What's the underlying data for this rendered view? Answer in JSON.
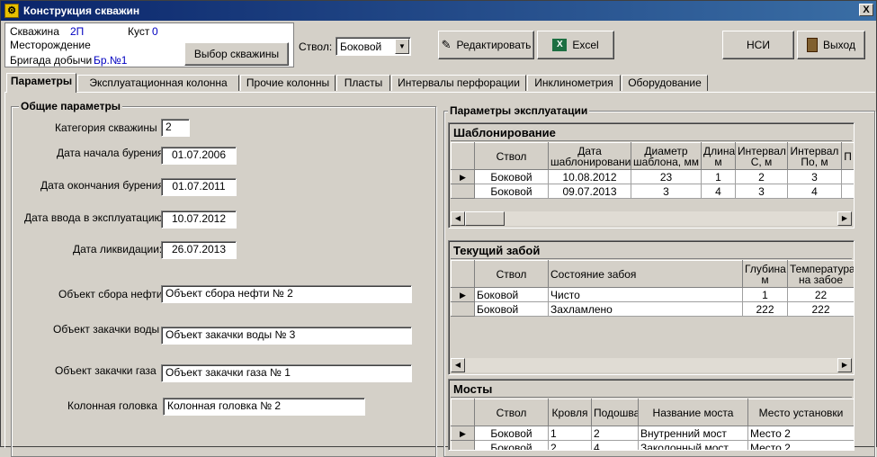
{
  "window": {
    "title": "Конструкция скважин",
    "close_label": "X"
  },
  "info": {
    "well_label": "Скважина",
    "well_value": "2П",
    "cluster_label": "Куст",
    "cluster_value": "0",
    "field_label": "Месторождение",
    "brigade_label": "Бригада добычи",
    "brigade_value": "Бр.№1"
  },
  "toolbar": {
    "select_well_label": "Выбор скважины",
    "trunk_label": "Ствол:",
    "trunk_value": "Боковой",
    "edit_label": "Редактировать",
    "excel_label": "Excel",
    "nsi_label": "НСИ",
    "exit_label": "Выход"
  },
  "tabs": [
    "Параметры",
    "Эксплуатационная колонна",
    "Прочие колонны",
    "Пласты",
    "Интервалы перфорации",
    "Инклинометрия",
    "Оборудование"
  ],
  "general": {
    "title": "Общие параметры",
    "category_label": "Категория скважины",
    "category_value": "2",
    "drill_start_label": "Дата начала бурения",
    "drill_start_value": "01.07.2006",
    "drill_end_label": "Дата окончания бурения",
    "drill_end_value": "01.07.2011",
    "commission_label": "Дата ввода в эксплуатацию",
    "commission_value": "10.07.2012",
    "liquidation_label": "Дата ликвидации:",
    "liquidation_value": "26.07.2013",
    "oil_label": "Объект сбора нефти",
    "oil_value": "Объект сбора нефти № 2",
    "water_label": "Объект закачки воды",
    "water_value": "Объект закачки воды № 3",
    "gas_label": "Объект закачки газа",
    "gas_value": "Объект закачки газа № 1",
    "head_label": "Колонная головка",
    "head_value": "Колонная головка № 2"
  },
  "exploitation": {
    "title": "Параметры эксплуатации",
    "templating": {
      "title": "Шаблонирование",
      "columns": [
        "Ствол",
        "Дата шаблонирования",
        "Диаметр шаблона, мм",
        "Длина м",
        "Интервал С, м",
        "Интервал По, м",
        "П"
      ],
      "rows": [
        [
          "Боковой",
          "10.08.2012",
          "23",
          "1",
          "2",
          "3"
        ],
        [
          "Боковой",
          "09.07.2013",
          "3",
          "4",
          "3",
          "4"
        ]
      ]
    },
    "bottomhole": {
      "title": "Текущий забой",
      "columns": [
        "Ствол",
        "Состояние забоя",
        "Глубина м",
        "Температура на забое"
      ],
      "rows": [
        [
          "Боковой",
          "Чисто",
          "1",
          "22"
        ],
        [
          "Боковой",
          "Захламлено",
          "222",
          "222"
        ]
      ]
    },
    "bridges": {
      "title": "Мосты",
      "columns": [
        "Ствол",
        "Кровля",
        "Подошва",
        "Название моста",
        "Место установки"
      ],
      "rows": [
        [
          "Боковой",
          "1",
          "2",
          "Внутренний мост",
          "Место 2"
        ],
        [
          "Боковой",
          "2",
          "4",
          "Заколонный мост",
          "Место 2"
        ]
      ]
    }
  }
}
